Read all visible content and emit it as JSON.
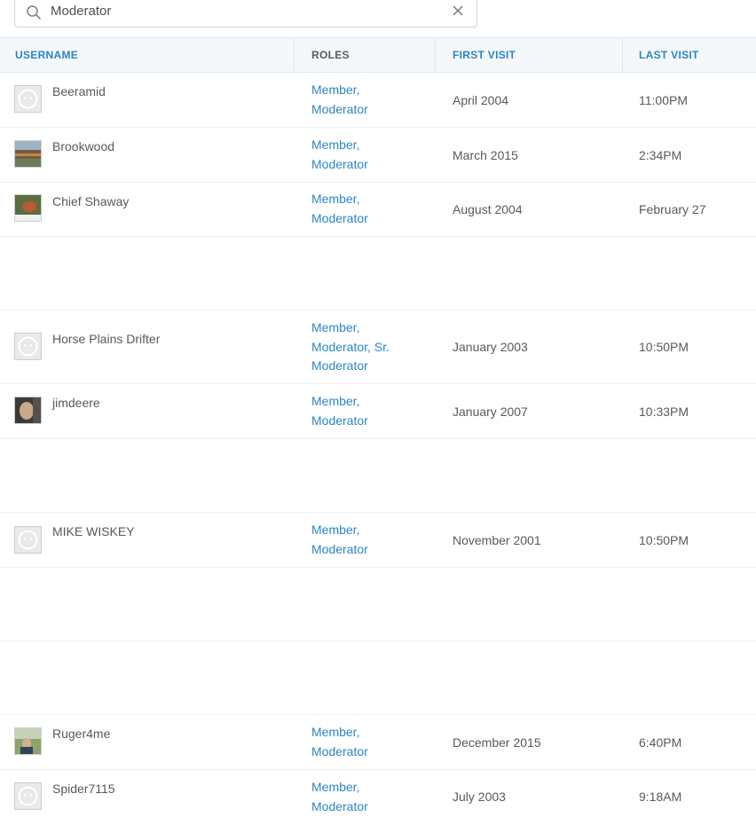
{
  "search": {
    "value": "Moderator"
  },
  "columns": {
    "username": "USERNAME",
    "roles": "ROLES",
    "first_visit": "FIRST VISIT",
    "last_visit": "LAST VISIT"
  },
  "members": [
    {
      "username": "Beeramid",
      "roles": [
        "Member,",
        "Moderator"
      ],
      "first_visit": "April 2004",
      "last_visit": "11:00PM",
      "avatar": "default-avatar-icon"
    },
    {
      "username": "Brookwood",
      "roles": [
        "Member,",
        "Moderator"
      ],
      "first_visit": "March 2015",
      "last_visit": "2:34PM",
      "avatar": "photo-avatar"
    },
    {
      "username": "Chief Shaway",
      "roles": [
        "Member,",
        "Moderator"
      ],
      "first_visit": "August 2004",
      "last_visit": "February 27",
      "avatar": "photo-avatar"
    },
    {
      "username": "Horse Plains Drifter",
      "roles": [
        "Member,",
        "Moderator, Sr.",
        "Moderator"
      ],
      "first_visit": "January 2003",
      "last_visit": "10:50PM",
      "avatar": "default-avatar-icon"
    },
    {
      "username": "jimdeere",
      "roles": [
        "Member,",
        "Moderator"
      ],
      "first_visit": "January 2007",
      "last_visit": "10:33PM",
      "avatar": "photo-avatar"
    },
    {
      "username": "MIKE WISKEY",
      "roles": [
        "Member,",
        "Moderator"
      ],
      "first_visit": "November 2001",
      "last_visit": "10:50PM",
      "avatar": "default-avatar-icon"
    },
    {
      "username": "Ruger4me",
      "roles": [
        "Member,",
        "Moderator"
      ],
      "first_visit": "December 2015",
      "last_visit": "6:40PM",
      "avatar": "photo-avatar"
    },
    {
      "username": "Spider7115",
      "roles": [
        "Member,",
        "Moderator"
      ],
      "first_visit": "July 2003",
      "last_visit": "9:18AM",
      "avatar": "default-avatar-icon"
    }
  ],
  "colors": {
    "link": "#2a86c6",
    "text": "#555a5f",
    "header_bg": "#f4f8fb"
  }
}
